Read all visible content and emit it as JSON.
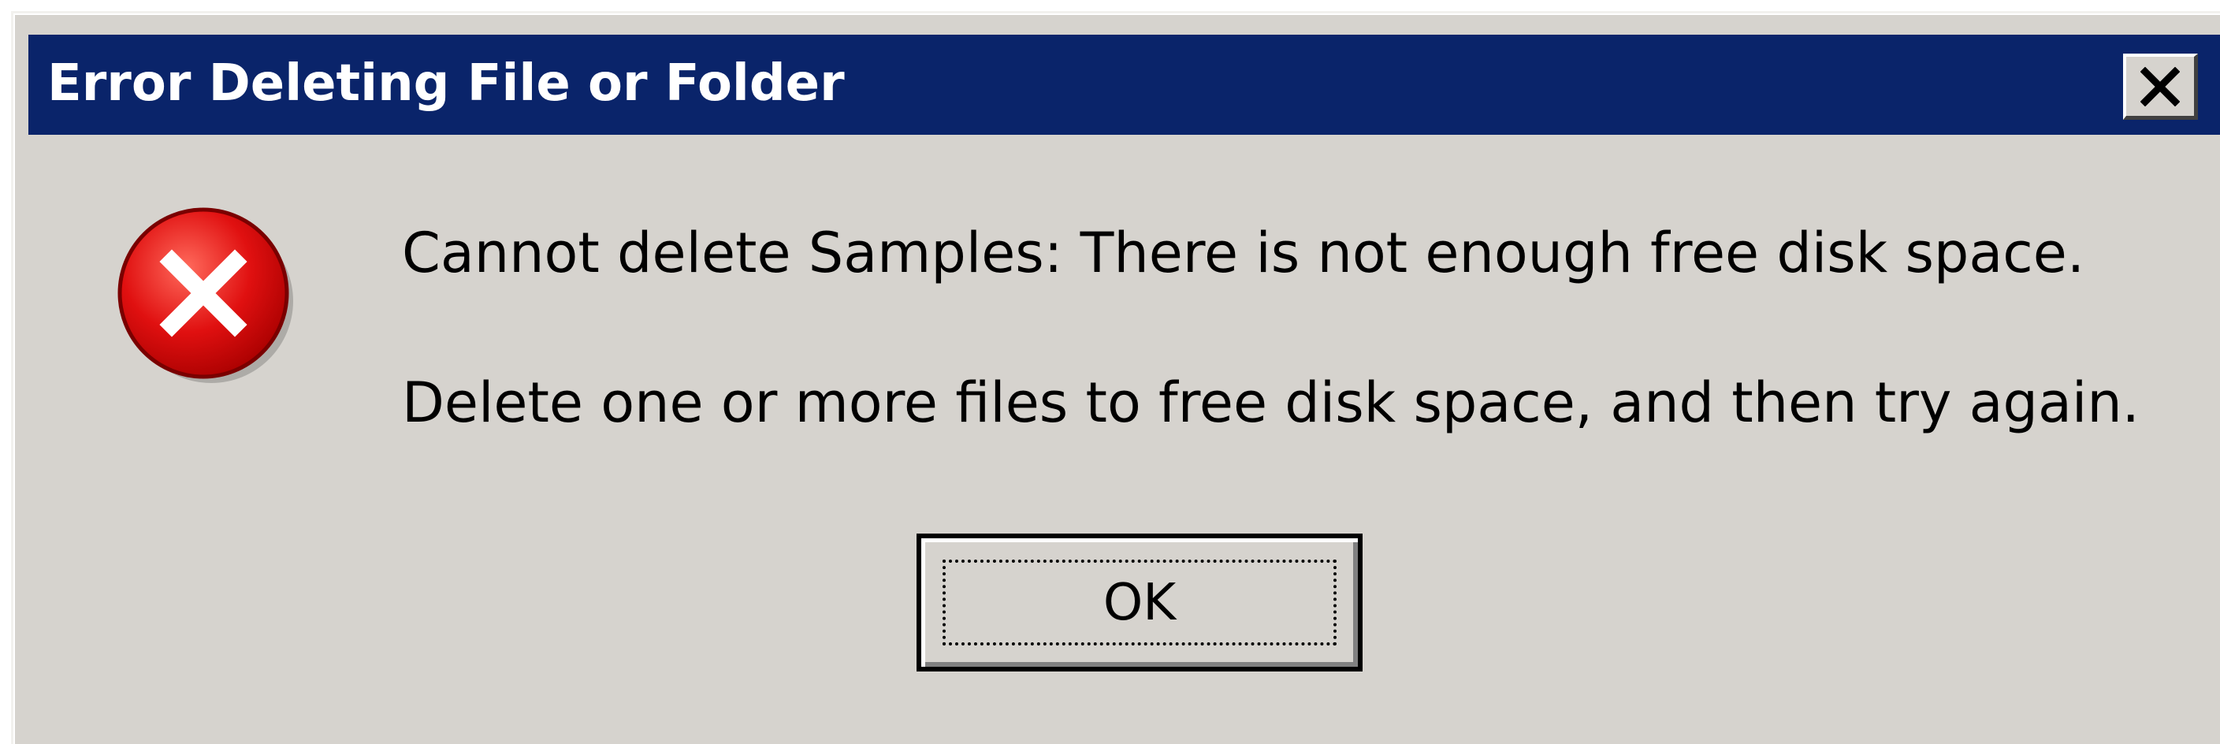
{
  "dialog": {
    "title": "Error Deleting File or Folder",
    "close_icon": "close-x-icon",
    "icon": "error-icon",
    "message_line_1": "Cannot delete Samples: There is not enough free disk space.",
    "message_line_2": "Delete one or more files to free disk space, and then try again.",
    "ok_label": "OK"
  },
  "colors": {
    "titlebar": "#0a246a",
    "dialog_face": "#d6d3ce",
    "error_red": "#e01010"
  }
}
